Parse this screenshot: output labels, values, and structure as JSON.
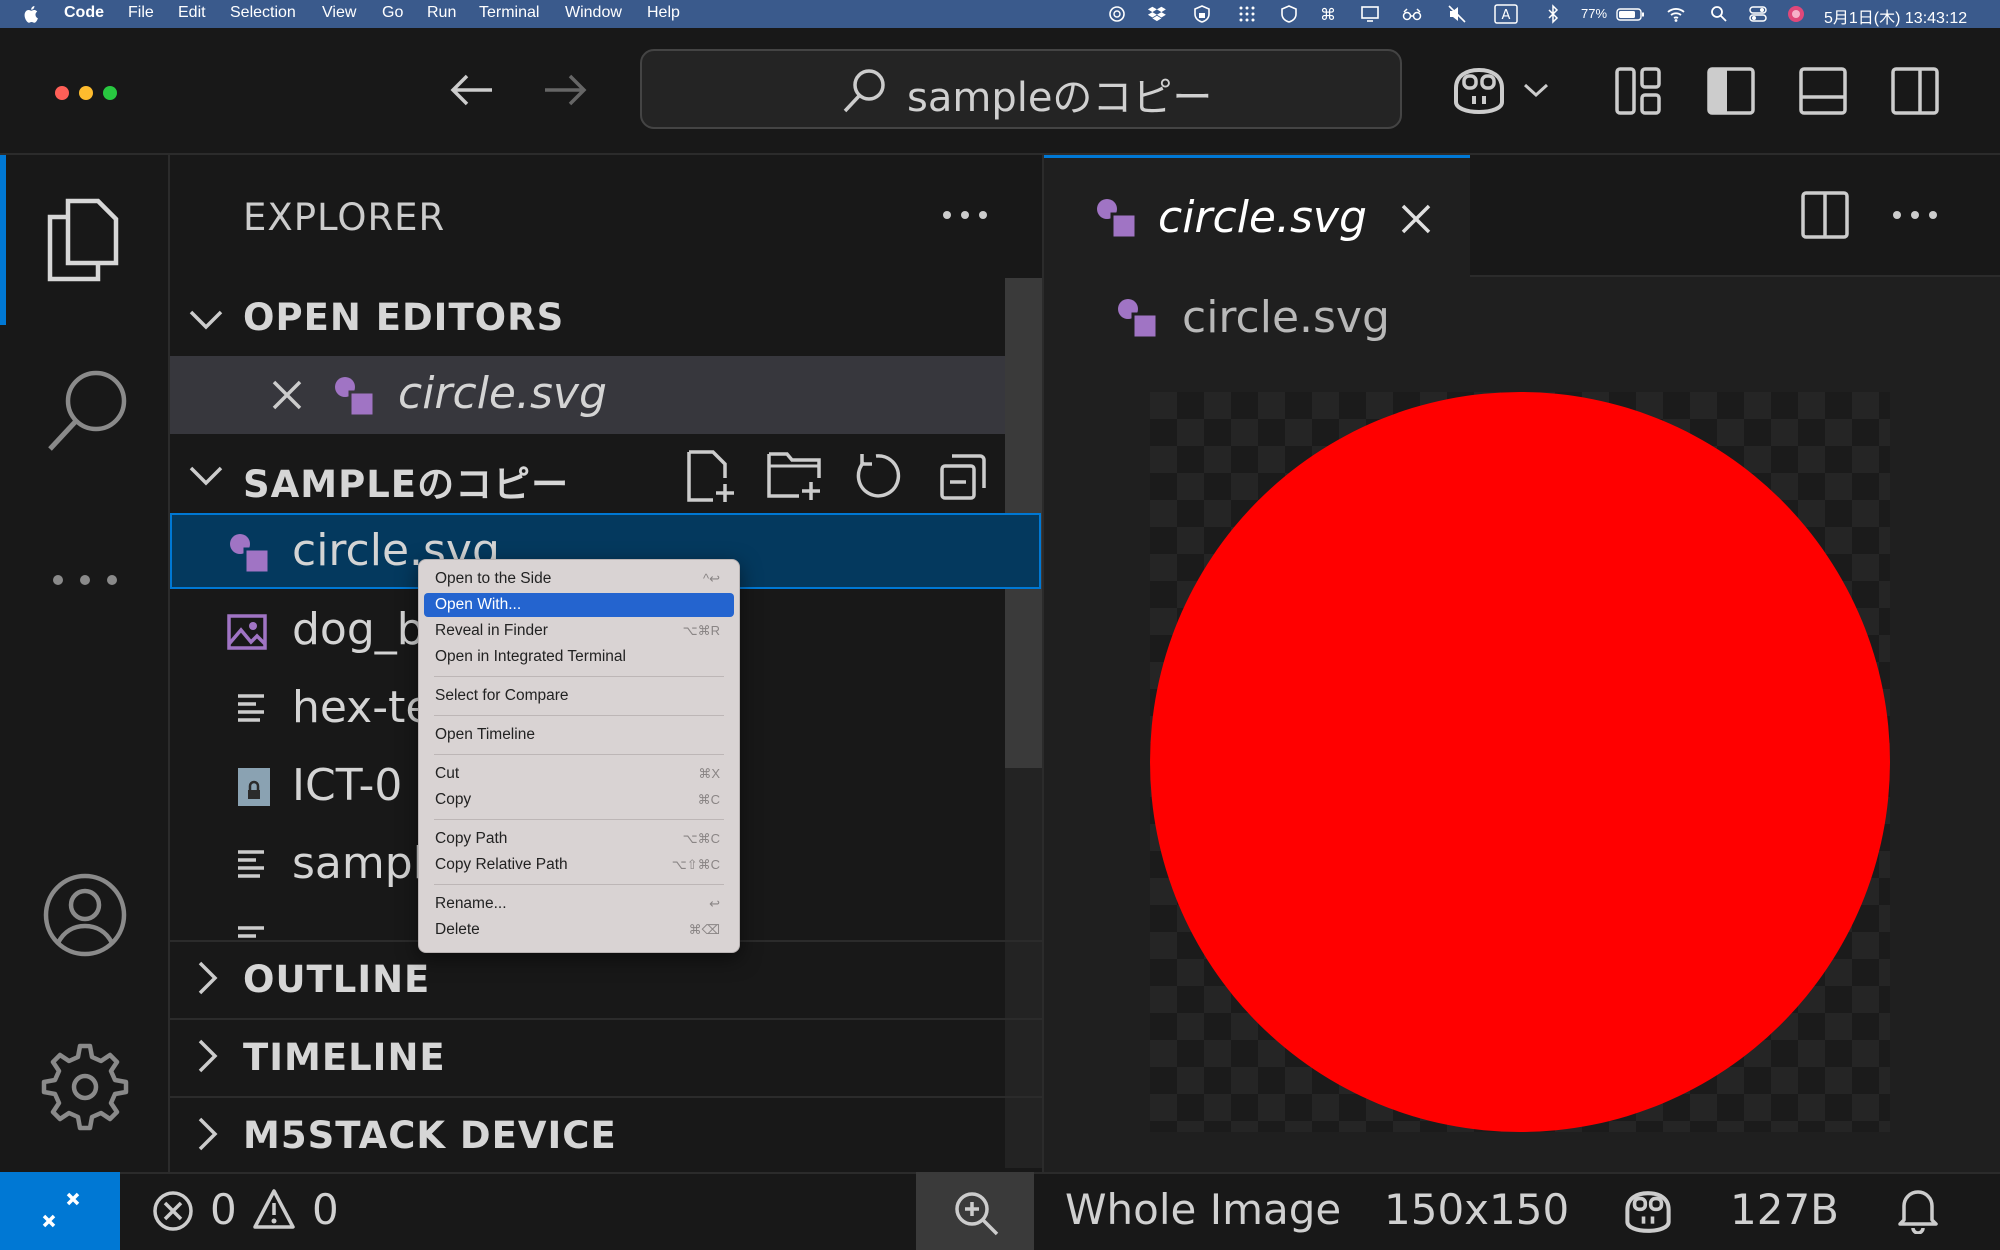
{
  "menubar": {
    "app_name": "Code",
    "items": [
      "File",
      "Edit",
      "Selection",
      "View",
      "Go",
      "Run",
      "Terminal",
      "Window",
      "Help"
    ],
    "battery": "77%",
    "ime": "A",
    "datetime": "5月1日(木) 13:43:12"
  },
  "titlebar": {
    "search_text": "sampleのコピー"
  },
  "activity": {
    "icons": [
      "files-icon",
      "search-icon",
      "more-icon",
      "account-icon",
      "settings-icon"
    ]
  },
  "sidebar": {
    "title": "EXPLORER",
    "open_editors": {
      "title": "OPEN EDITORS",
      "items": [
        {
          "name": "circle.svg"
        }
      ]
    },
    "folder": {
      "title": "SAMPLEのコピー",
      "files": [
        {
          "name": "circle.svg",
          "icon": "svg-file-icon"
        },
        {
          "name": "dog_b",
          "icon": "image-file-icon"
        },
        {
          "name": "hex-te",
          "icon": "text-file-icon"
        },
        {
          "name": "ICT-0",
          "icon": "locked-file-icon"
        },
        {
          "name": "sampl",
          "icon": "text-file-icon"
        }
      ]
    },
    "sections": [
      "OUTLINE",
      "TIMELINE",
      "M5STACK DEVICE"
    ]
  },
  "context_menu": {
    "items": [
      {
        "label": "Open to the Side",
        "shortcut": "^↩"
      },
      {
        "label": "Open With...",
        "shortcut": "",
        "highlighted": true
      },
      {
        "label": "Reveal in Finder",
        "shortcut": "⌥⌘R"
      },
      {
        "label": "Open in Integrated Terminal",
        "shortcut": ""
      },
      {
        "label": "Select for Compare",
        "shortcut": ""
      },
      {
        "label": "Open Timeline",
        "shortcut": ""
      },
      {
        "label": "Cut",
        "shortcut": "⌘X"
      },
      {
        "label": "Copy",
        "shortcut": "⌘C"
      },
      {
        "label": "Copy Path",
        "shortcut": "⌥⌘C"
      },
      {
        "label": "Copy Relative Path",
        "shortcut": "⌥⇧⌘C"
      },
      {
        "label": "Rename...",
        "shortcut": "↩"
      },
      {
        "label": "Delete",
        "shortcut": "⌘⌫"
      }
    ]
  },
  "editor": {
    "tab_title": "circle.svg",
    "breadcrumb": "circle.svg",
    "image_fill": "#ff0000"
  },
  "statusbar": {
    "errors": "0",
    "warnings": "0",
    "zoom_label": "Whole Image",
    "dimensions": "150x150",
    "size": "127B"
  }
}
